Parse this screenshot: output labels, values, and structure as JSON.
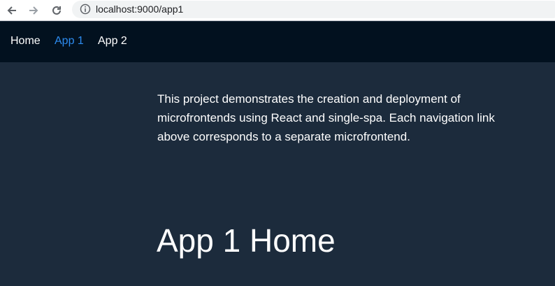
{
  "browser": {
    "url": "localhost:9000/app1",
    "back_icon": "arrow-left-icon",
    "forward_icon": "arrow-right-icon",
    "reload_icon": "reload-icon",
    "info_icon": "info-icon"
  },
  "nav": {
    "items": [
      {
        "label": "Home",
        "active": false
      },
      {
        "label": "App 1",
        "active": true
      },
      {
        "label": "App 2",
        "active": false
      }
    ],
    "active_color": "#2d8cf0",
    "background": "#02111f"
  },
  "main": {
    "intro": "This project demonstrates the creation and deployment of microfrontends using React and single-spa. Each navigation link above corresponds to a separate microfrontend.",
    "title": "App 1 Home",
    "background": "#1c2b3c"
  }
}
